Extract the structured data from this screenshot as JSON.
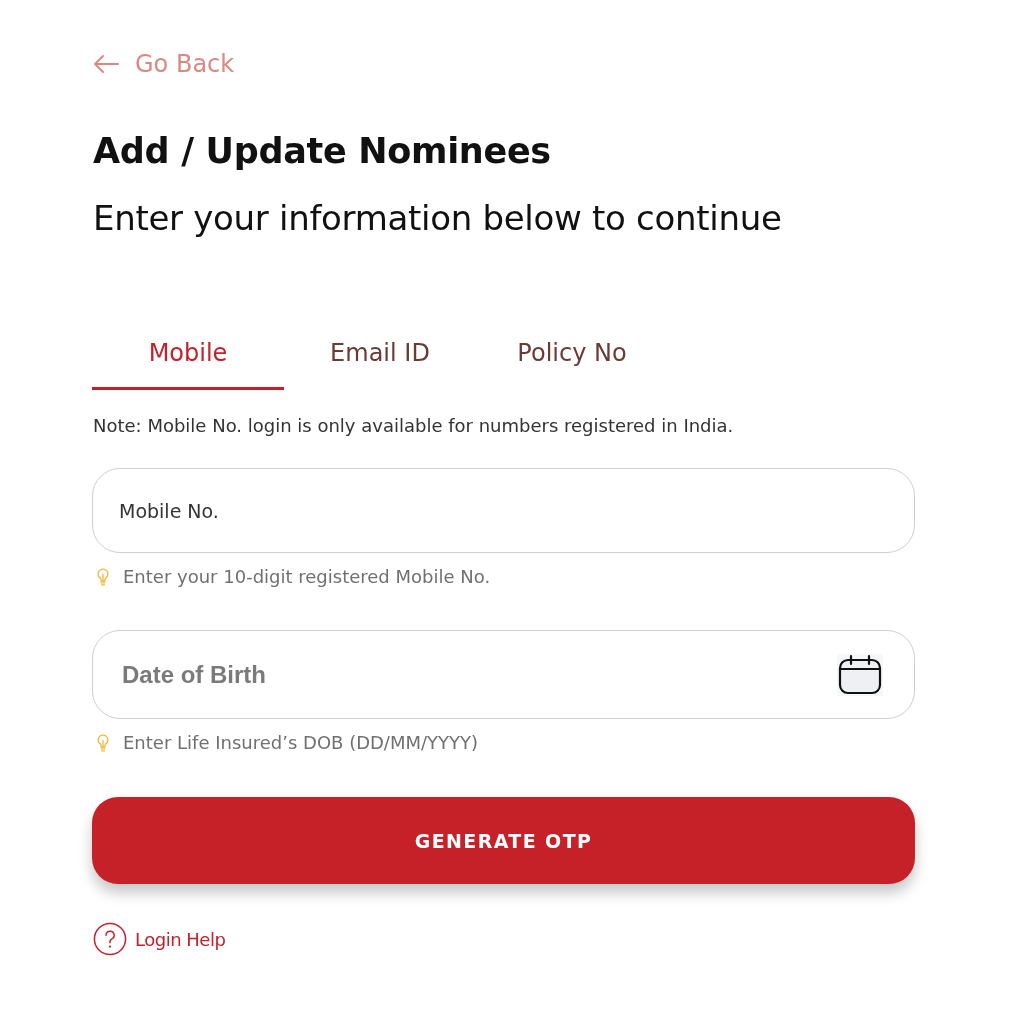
{
  "back_link": {
    "label": "Go Back"
  },
  "title": "Add / Update Nominees",
  "subtitle": "Enter your information below to continue",
  "tabs": [
    {
      "label": "Mobile",
      "selected": true
    },
    {
      "label": "Email ID",
      "selected": false
    },
    {
      "label": "Policy No",
      "selected": false
    }
  ],
  "note": "Note: Mobile No. login is only available for numbers registered in India.",
  "fields": [
    {
      "kind": "text",
      "placeholder": "Mobile No.",
      "hint": "Enter your 10-digit registered Mobile No."
    },
    {
      "kind": "date",
      "placeholder": "Date of Birth",
      "hint": "Enter Life Insured’s DOB (DD/MM/YYYY)"
    }
  ],
  "primary_button": {
    "label": "GENERATE OTP"
  },
  "help_link": {
    "label": "Login Help"
  }
}
